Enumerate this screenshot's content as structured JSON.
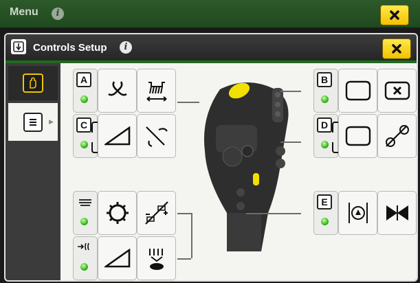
{
  "topbar": {
    "title": "Menu",
    "info_icon": "info-icon",
    "close_icon": "close-icon"
  },
  "dialog": {
    "title": "Controls Setup",
    "header_icon": "controls-setup-icon",
    "info_icon": "info-icon",
    "close_icon": "close-icon"
  },
  "sidebar": {
    "tabs": [
      {
        "icon": "hand-icon",
        "selected": true
      },
      {
        "icon": "control-bank-icon",
        "selected": false
      }
    ]
  },
  "groups": [
    {
      "letter": "A",
      "led": "green",
      "functions": [
        "fan-reverse-icon",
        "header-height-width-icon"
      ]
    },
    {
      "letter": "B",
      "led": "green",
      "functions": [
        "blank-function-icon",
        "cancel-icon"
      ]
    },
    {
      "letter": "C",
      "led": "green",
      "functions": [
        "ramp-increase-icon",
        "ramp-decrease-icon"
      ]
    },
    {
      "letter": "D",
      "led": "green",
      "functions": [
        "blank-function-icon",
        "steer-arrows-icon"
      ]
    },
    {
      "letter": "E",
      "led": "green",
      "functions": [
        "valve-icon",
        "bowtie-icon"
      ]
    },
    {
      "letter": "",
      "led": "green",
      "functions": [
        "ramp-increase-icon",
        "turtle-speed-icon"
      ]
    },
    {
      "letter": "",
      "led": "green",
      "functions": [
        "gear-icon",
        "tractor-plus-minus-icon"
      ]
    }
  ],
  "colors": {
    "topbar": "#2d5a2a",
    "accent_yellow": "#f2c200",
    "led_green": "#33b81e",
    "panel": "#f4f4f0"
  }
}
